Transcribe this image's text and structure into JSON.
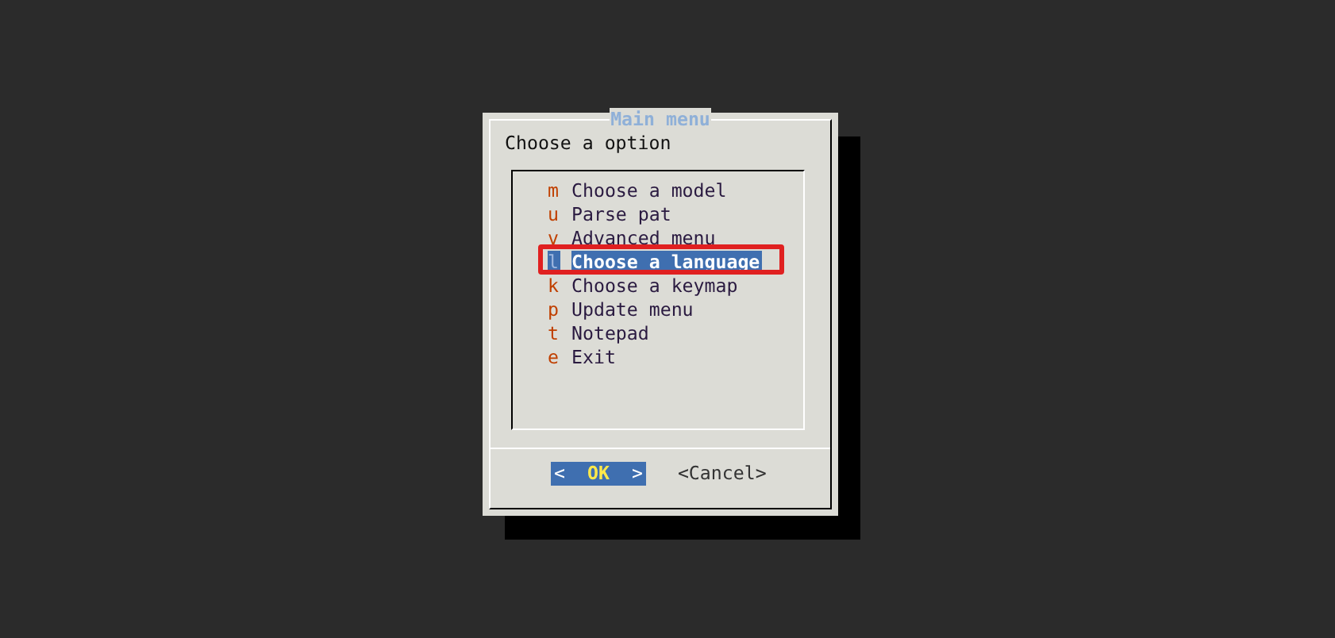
{
  "dialog": {
    "title": "Main menu",
    "prompt": "Choose a option"
  },
  "items": [
    {
      "key": "m",
      "label": "Choose a model",
      "selected": false,
      "highlighted": false
    },
    {
      "key": "u",
      "label": "Parse pat",
      "selected": false,
      "highlighted": false
    },
    {
      "key": "v",
      "label": "Advanced menu",
      "selected": false,
      "highlighted": false
    },
    {
      "key": "l",
      "label": "Choose a language",
      "selected": true,
      "highlighted": true
    },
    {
      "key": "k",
      "label": "Choose a keymap",
      "selected": false,
      "highlighted": false
    },
    {
      "key": "p",
      "label": "Update menu",
      "selected": false,
      "highlighted": false
    },
    {
      "key": "t",
      "label": "Notepad",
      "selected": false,
      "highlighted": false
    },
    {
      "key": "e",
      "label": "Exit",
      "selected": false,
      "highlighted": false
    }
  ],
  "buttons": [
    {
      "open": "<",
      "label": "OK",
      "close": ">",
      "selected": true
    },
    {
      "open": "<",
      "label": "Cancel",
      "close": ">",
      "selected": false
    }
  ]
}
